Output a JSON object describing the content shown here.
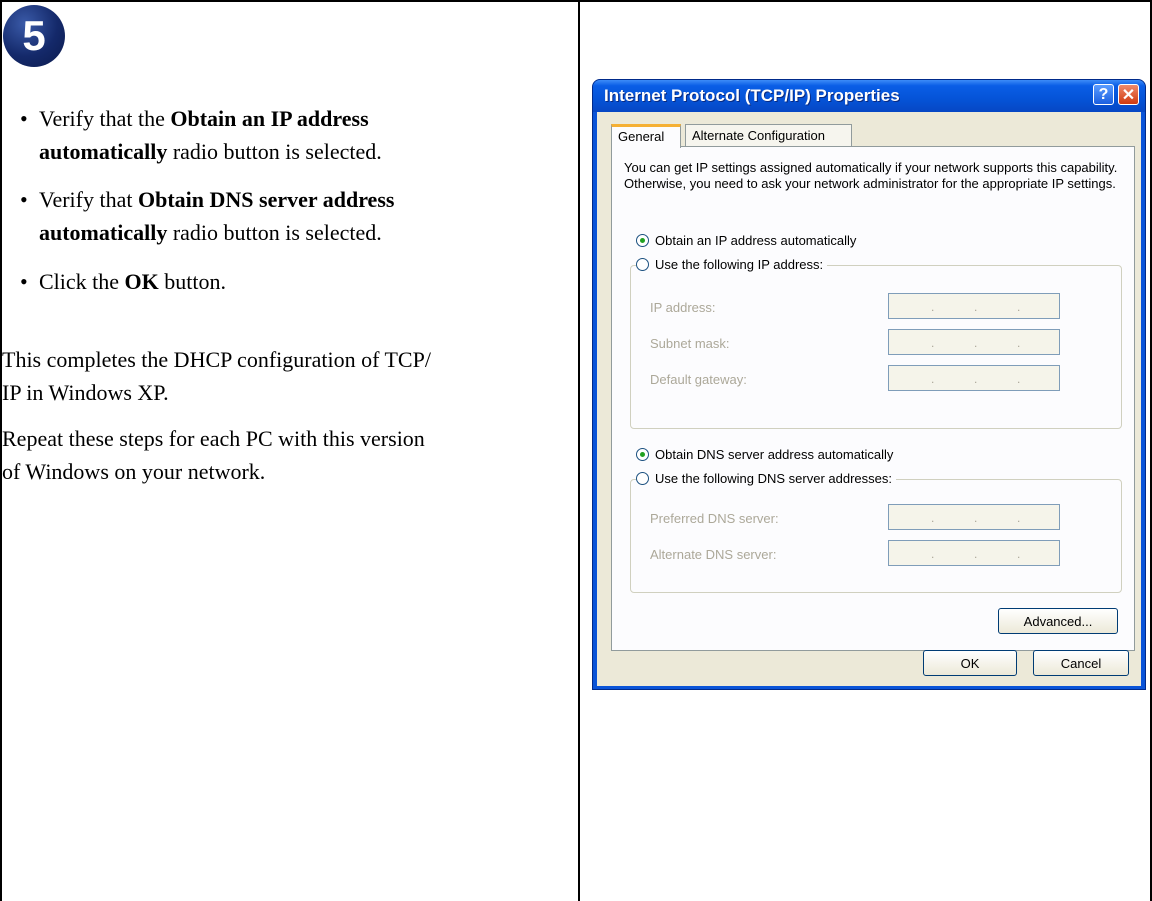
{
  "step": {
    "number": "5"
  },
  "instructions": {
    "bullet_char": "•",
    "bullets": [
      {
        "line1_pre": "Verify that the ",
        "line1_bold": "Obtain an IP address",
        "line2_bold": "automatically",
        "line2_post": " radio button is selected."
      },
      {
        "line1_pre": "Verify that ",
        "line1_bold": "Obtain DNS server address",
        "line2_bold": "automatically",
        "line2_post": " radio button is selected."
      },
      {
        "pre": "Click the ",
        "bold": "OK",
        "post": " button."
      }
    ],
    "para1_line1": "This completes the DHCP configuration of TCP/",
    "para1_line2": "IP in Windows XP.",
    "para2_line1": "Repeat these steps for each PC with this version",
    "para2_line2": "of Windows on your network."
  },
  "dialog": {
    "title": "Internet Protocol (TCP/IP) Properties",
    "help_glyph": "?",
    "close_glyph": "✕",
    "tabs": {
      "general": "General",
      "alternate": "Alternate Configuration"
    },
    "description": "You can get IP settings assigned automatically if your network supports this capability. Otherwise, you need to ask your network administrator for the appropriate IP settings.",
    "ip_auto_label": "Obtain an IP address automatically",
    "ip_manual_label": "Use the following IP address:",
    "ip_address_label": "IP address:",
    "subnet_mask_label": "Subnet mask:",
    "gateway_label": "Default gateway:",
    "dns_auto_label": "Obtain DNS server address automatically",
    "dns_manual_label": "Use the following DNS server addresses:",
    "preferred_dns_label": "Preferred DNS server:",
    "alternate_dns_label": "Alternate DNS server:",
    "ip_separator": ".",
    "advanced_button": "Advanced...",
    "ok_button": "OK",
    "cancel_button": "Cancel"
  },
  "colors": {
    "title_blue": "#0a54d8",
    "dialog_face": "#ece9d8",
    "badge": "#14296a"
  }
}
